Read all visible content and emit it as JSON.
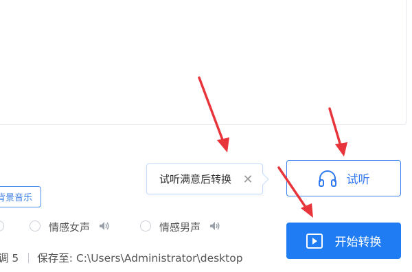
{
  "bgm_button": {
    "label": "背景音乐"
  },
  "tooltip": {
    "text": "试听满意后转换",
    "close_glyph": "✕"
  },
  "listen_button": {
    "label": "试听",
    "icon": "headphones-icon"
  },
  "start_button": {
    "label": "开始转换",
    "icon": "play-icon"
  },
  "voices": [
    {
      "label": "情感女声",
      "icon": "speaker-icon"
    },
    {
      "label": "情感男声",
      "icon": "speaker-icon"
    }
  ],
  "status": {
    "tone": "调 5",
    "save_path": "保存至: C:\\Users\\Administrator\\desktop"
  },
  "colors": {
    "accent": "#1f7cf3",
    "annotation_arrow": "#e8353b"
  }
}
